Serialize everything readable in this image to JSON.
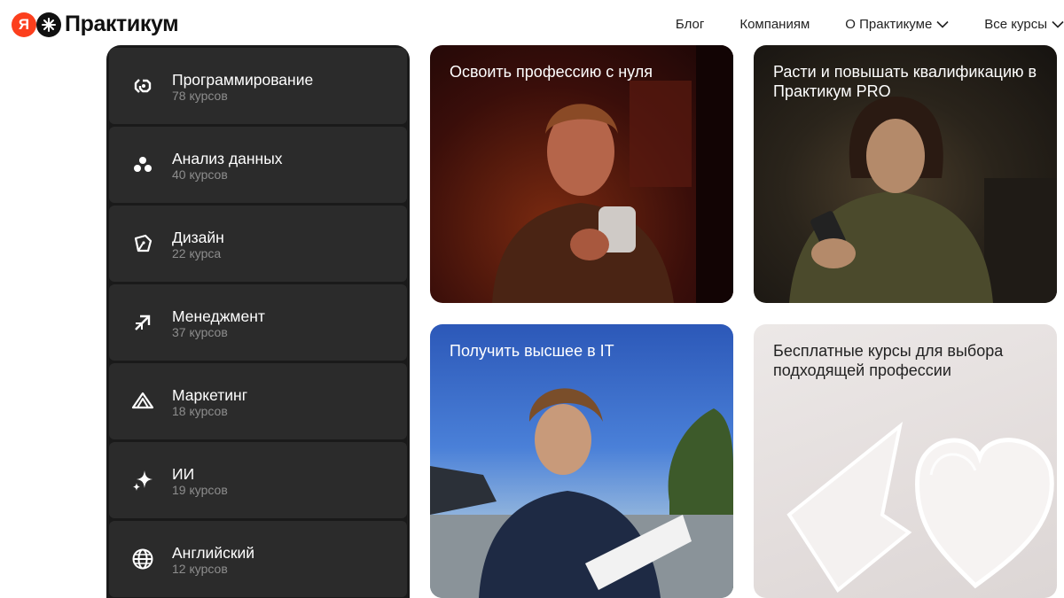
{
  "header": {
    "logo_text": "Практикум",
    "logo_letter": "Я",
    "nav": {
      "blog": "Блог",
      "companies": "Компаниям",
      "about": "О Практикуме",
      "all_courses": "Все курсы"
    }
  },
  "sidebar": {
    "items": [
      {
        "title": "Программирование",
        "count": "78 курсов",
        "icon": "code-icon"
      },
      {
        "title": "Анализ данных",
        "count": "40 курсов",
        "icon": "dots-cluster-icon"
      },
      {
        "title": "Дизайн",
        "count": "22 курса",
        "icon": "pen-nib-icon"
      },
      {
        "title": "Менеджмент",
        "count": "37 курсов",
        "icon": "arrow-up-right-icon"
      },
      {
        "title": "Маркетинг",
        "count": "18 курсов",
        "icon": "triangles-icon"
      },
      {
        "title": "ИИ",
        "count": "19 курсов",
        "icon": "sparkles-icon"
      },
      {
        "title": "Английский",
        "count": "12 курсов",
        "icon": "globe-icon"
      }
    ]
  },
  "cards": [
    {
      "title": "Освоить профессию с нуля"
    },
    {
      "title": "Расти и повышать квалификацию в Практикум PRO"
    },
    {
      "title": "Получить высшее в IT"
    },
    {
      "title": "Бесплатные курсы для выбора подходящей профессии"
    }
  ],
  "colors": {
    "brand_red": "#fc3f1d",
    "sidebar_bg": "#1a1a1a",
    "sidebar_item_bg": "#2b2b2b"
  }
}
